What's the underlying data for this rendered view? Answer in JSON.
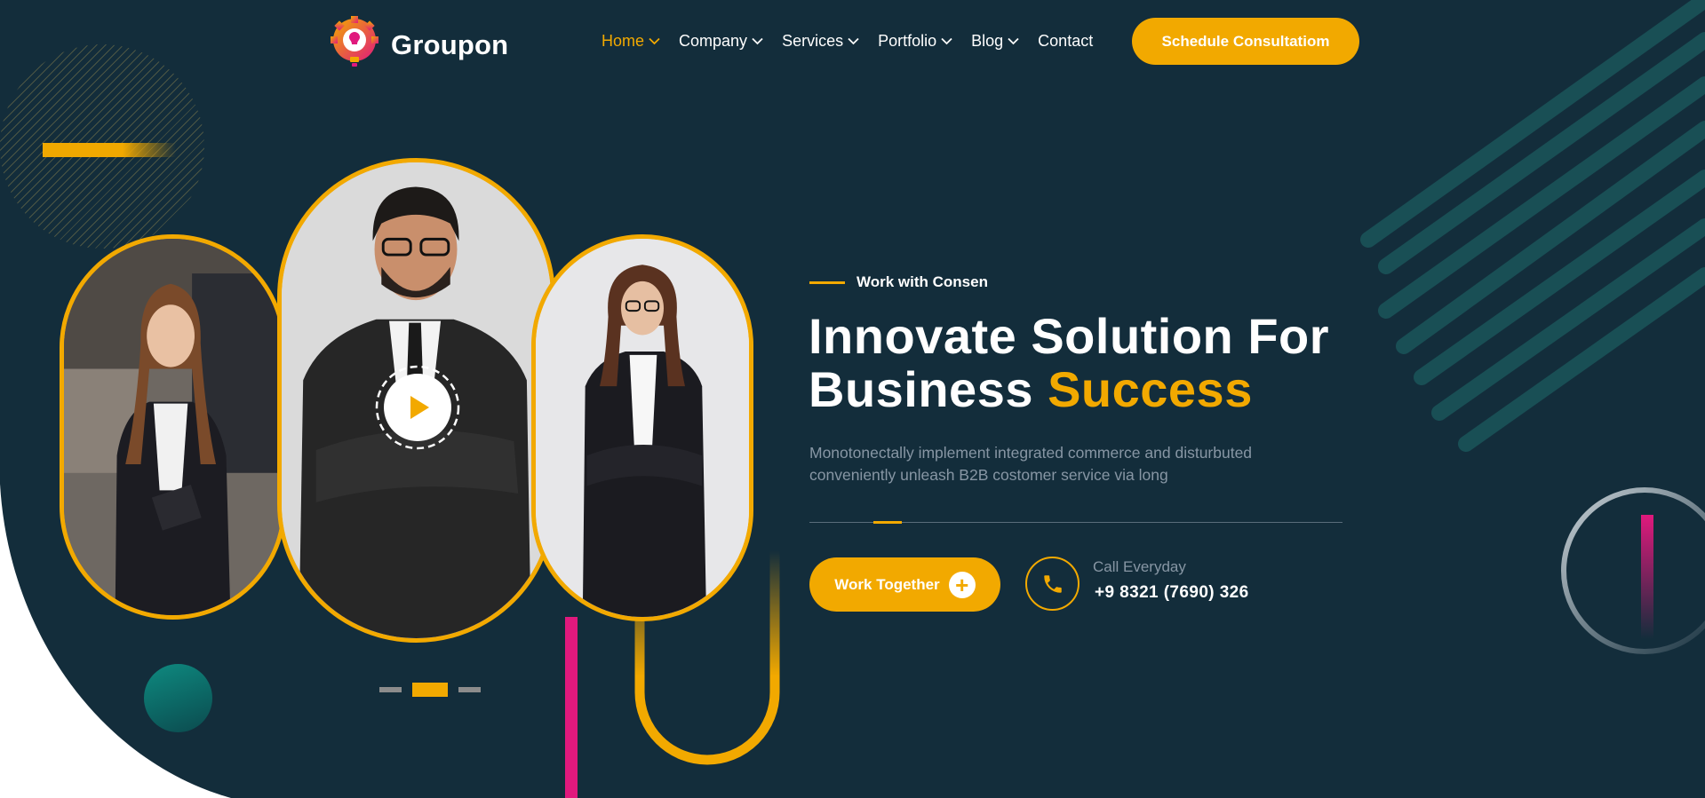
{
  "brand": {
    "name": "Groupon",
    "logo_icon": "lightbulb-gear-icon"
  },
  "nav": {
    "items": [
      {
        "label": "Home",
        "has_dropdown": true,
        "active": true
      },
      {
        "label": "Company",
        "has_dropdown": true
      },
      {
        "label": "Services",
        "has_dropdown": true
      },
      {
        "label": "Portfolio",
        "has_dropdown": true
      },
      {
        "label": "Blog",
        "has_dropdown": true
      },
      {
        "label": "Contact",
        "has_dropdown": false
      }
    ],
    "cta_label": "Schedule Consultatiom"
  },
  "hero": {
    "tagline": "Work with Consen",
    "headline_line1": "Innovate Solution For",
    "headline_line2": "Business ",
    "headline_highlight": "Success",
    "description": "Monotonectally implement integrated commerce and disturbuted conveniently unleash B2B costomer service via long",
    "button_label": "Work Together",
    "button_icon": "plus-icon",
    "call_label": "Call Everyday",
    "call_number": "+9 8321 (7690) 326",
    "call_icon": "phone-icon"
  },
  "slider": {
    "dots": 3,
    "active_index": 1
  },
  "colors": {
    "background": "#132d3b",
    "accent": "#f2a900",
    "pink": "#e0197d",
    "teal": "#0e8a80",
    "text_muted": "#8796a4",
    "white": "#ffffff"
  }
}
